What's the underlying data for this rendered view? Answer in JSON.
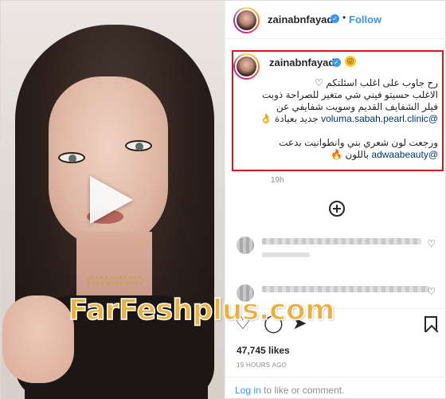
{
  "post": {
    "username": "zainabnfayad",
    "verified_mark": "✓",
    "follow_label": "Follow",
    "separator": "•"
  },
  "caption": {
    "username": "zainabnfayad",
    "emoji": "😜",
    "lines": [
      "رح جاوب على اغلب اسئلتكم ♡",
      "الاغلب حسيتو فيني شي متغير للصراحة ذوبت",
      "فيلر الشفايف القديم وسويت شفايفي عن",
      "@voluma.sabah.pearl.clinic جديد بعيادة 👌",
      "ورجعت لون شعري بني وانطوانيت بدعت",
      "@adwaabeauty باللون 🔥"
    ],
    "timestamp": "19h"
  },
  "actions": {
    "heart_icon": "♡",
    "comment_icon": "◯",
    "share_icon": "➤"
  },
  "stats": {
    "likes": "47,745 likes",
    "ago": "19 HOURS AGO"
  },
  "footer": {
    "login_link": "Log in",
    "rest": " to like or comment."
  },
  "watermark": {
    "text": "FarFeshplus.com"
  }
}
